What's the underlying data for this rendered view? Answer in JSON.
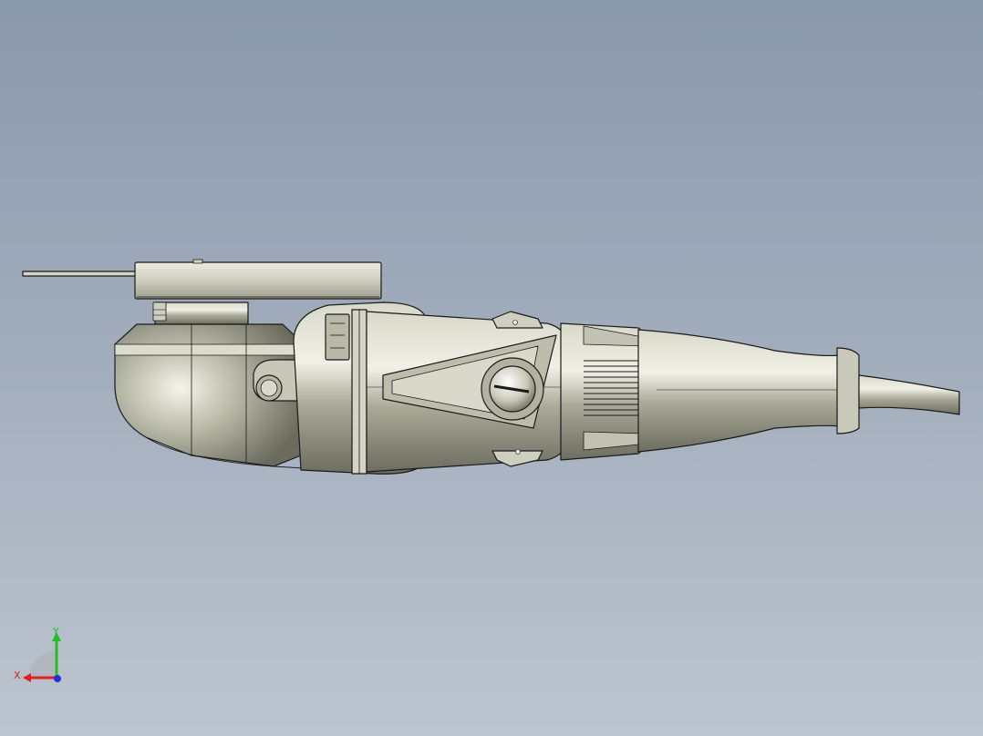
{
  "viewport": {
    "background_top": "#8a98ab",
    "background_bottom": "#bcc4cf"
  },
  "model": {
    "body_color": "#a9a998",
    "body_highlight": "#e4e4d8",
    "body_shadow": "#6d6d60",
    "outline_color": "#1a1a1a"
  },
  "triad": {
    "x_label": "X",
    "y_label": "Y",
    "x_color": "#e02020",
    "y_color": "#20c020",
    "z_color": "#2030e0"
  }
}
